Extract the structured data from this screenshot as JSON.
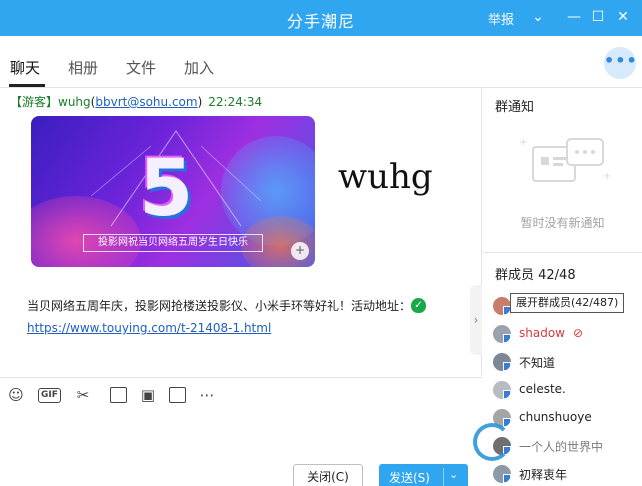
{
  "window": {
    "title": "分手潮尼",
    "report_label": "举报",
    "dropdown_glyph": "⌄",
    "minimize_glyph": "—",
    "maximize_glyph": "☐",
    "close_glyph": "✕"
  },
  "tabs": [
    {
      "label": "聊天",
      "active": true
    },
    {
      "label": "相册",
      "active": false
    },
    {
      "label": "文件",
      "active": false
    },
    {
      "label": "加入",
      "active": false
    }
  ],
  "more_glyph": "•••",
  "message": {
    "tag": "【游客】",
    "sender": "wuhg",
    "email": "bbvrt@sohu.com",
    "time": "22:24:34",
    "banner_numeral": "5",
    "banner_caption": "投影网祝当贝网络五周岁生日快乐",
    "banner_plus": "+",
    "big_name": "wuhg",
    "text": "当贝网络五周年庆，投影网抢楼送投影仪、小米手环等好礼！活动地址：",
    "link": "https://www.touying.com/t-21408-1.html",
    "verified_glyph": "✓"
  },
  "collapse_glyph": "›",
  "toolbar": {
    "emoji_icon": "☺",
    "gif_label": "GIF",
    "scissors_icon": "✂",
    "image_icon": "▣",
    "more_icon": "⋯"
  },
  "buttons": {
    "close_label": "关闭(C)",
    "send_label": "发送(S)",
    "send_arrow": "⌄"
  },
  "notice": {
    "title": "群通知",
    "empty_text": "暂时没有新通知"
  },
  "members": {
    "title": "群成员 42/48",
    "tooltip": "展开群成员(42/487)",
    "list": [
      {
        "name": "",
        "red": false
      },
      {
        "name": "shadow",
        "red": true
      },
      {
        "name": "不知道",
        "red": false
      },
      {
        "name": "celeste.",
        "red": false
      },
      {
        "name": "chunshuoye",
        "red": false
      },
      {
        "name": "一个人的世界中",
        "red": false
      },
      {
        "name": "初释衷年",
        "red": false
      }
    ]
  },
  "colors": {
    "accent": "#2fa6ef",
    "link": "#1f5fbf",
    "sender": "#1a7d2b"
  }
}
